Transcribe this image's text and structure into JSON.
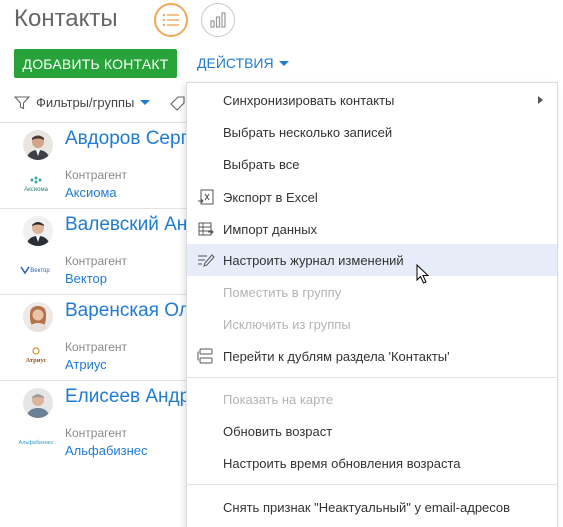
{
  "header": {
    "title": "Контакты",
    "add_button": "ДОБАВИТЬ КОНТАКТ",
    "actions_button": "ДЕЙСТВИЯ"
  },
  "filters": {
    "label": "Фильтры/группы"
  },
  "contacts": [
    {
      "name": "Авдоров Сергей",
      "account_label": "Контрагент",
      "account": "Аксиома",
      "logo_text": "Аксиома"
    },
    {
      "name": "Валевский Андрей",
      "account_label": "Контрагент",
      "account": "Вектор",
      "logo_text": "Вектор"
    },
    {
      "name": "Варенская Ольга",
      "account_label": "Контрагент",
      "account": "Атриус",
      "logo_text": "Атриус"
    },
    {
      "name": "Елисеев Андрей",
      "account_label": "Контрагент",
      "account": "Альфабизнес",
      "logo_text": "Альфабизнес"
    }
  ],
  "menu": {
    "items": [
      {
        "label": "Синхронизировать контакты",
        "state": "normal",
        "submenu": true
      },
      {
        "label": "Выбрать несколько записей",
        "state": "normal"
      },
      {
        "label": "Выбрать все",
        "state": "normal"
      },
      {
        "label": "Экспорт в Excel",
        "state": "normal",
        "icon": "excel-export-icon"
      },
      {
        "label": "Импорт данных",
        "state": "normal",
        "icon": "import-data-icon"
      },
      {
        "label": "Настроить журнал изменений",
        "state": "hover",
        "icon": "change-log-icon"
      },
      {
        "label": "Поместить в группу",
        "state": "disabled"
      },
      {
        "label": "Исключить из группы",
        "state": "disabled"
      },
      {
        "label": "Перейти к дублям раздела 'Контакты'",
        "state": "normal",
        "icon": "duplicates-icon"
      },
      {
        "label": "Показать на карте",
        "state": "disabled"
      },
      {
        "label": "Обновить возраст",
        "state": "normal"
      },
      {
        "label": "Настроить время обновления возраста",
        "state": "normal"
      },
      {
        "label": "Снять признак \"Неактуальный\" у email-адресов",
        "state": "normal"
      }
    ]
  },
  "colors": {
    "accent_green": "#27a33a",
    "link_blue": "#1f7bd3",
    "view_active_orange": "#f0a85a",
    "hover_bg": "#e6edf8",
    "disabled_text": "#b4b4b4"
  }
}
